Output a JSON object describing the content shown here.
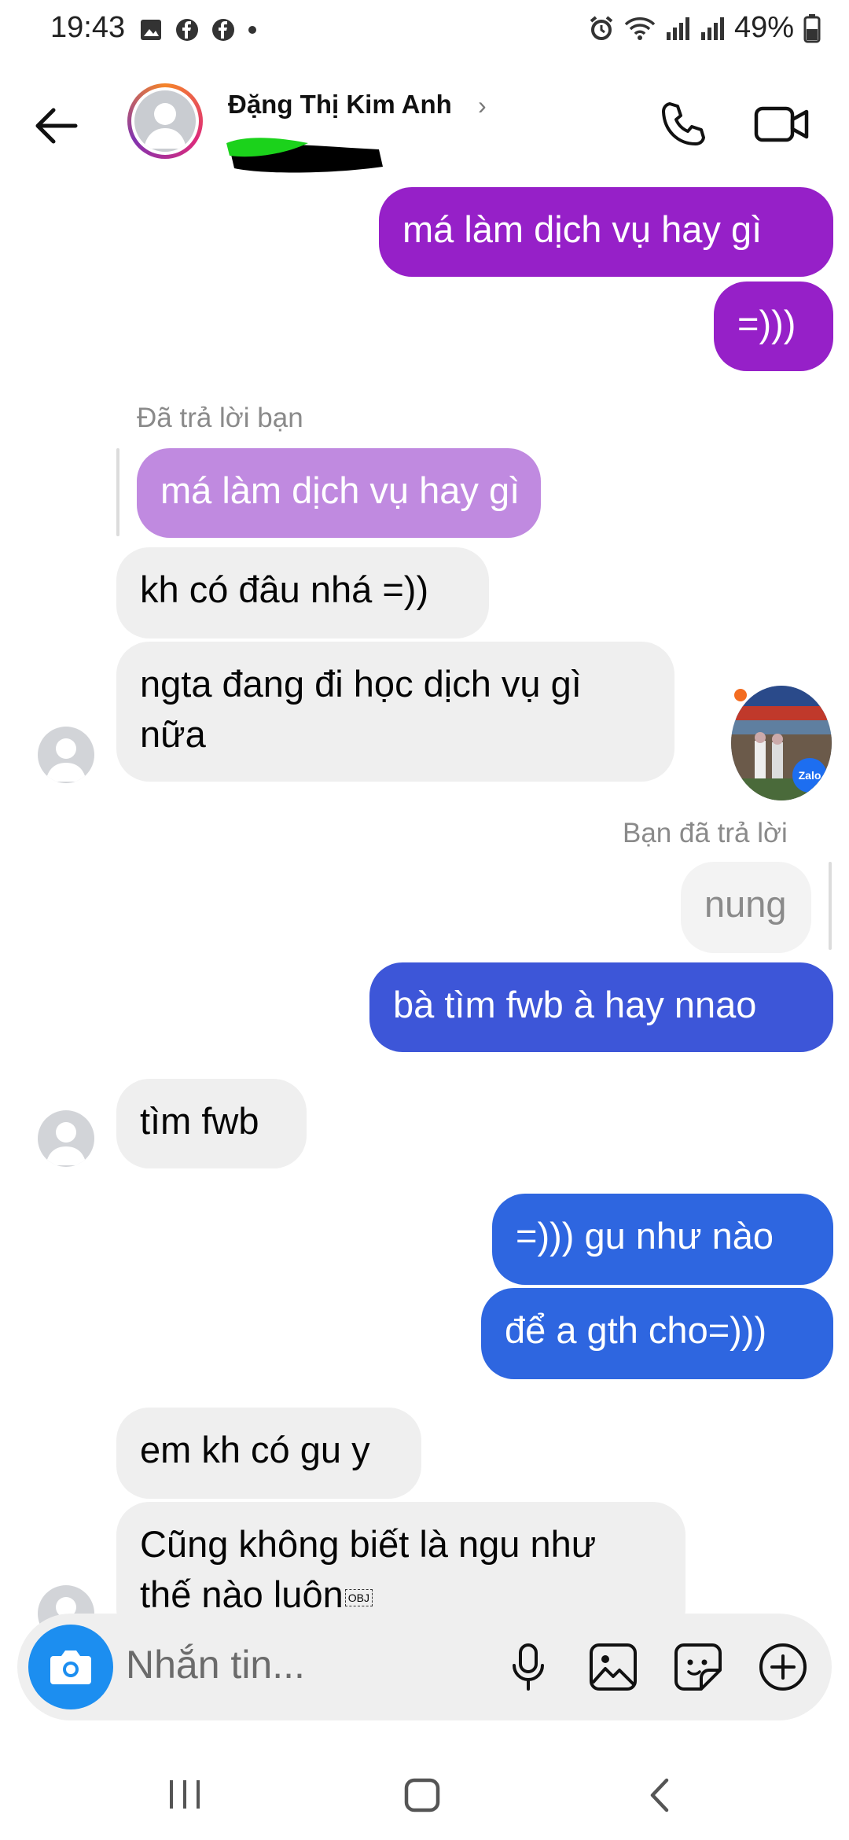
{
  "status_bar": {
    "time": "19:43",
    "battery": "49%"
  },
  "header": {
    "contact_name": "Đặng Thị Kim Anh",
    "chevron": "›"
  },
  "messages": [
    {
      "side": "out",
      "text": "má làm dịch vụ hay gì"
    },
    {
      "side": "out",
      "text": "=)))"
    },
    {
      "side": "in",
      "reply_label": "Đã trả lời bạn",
      "quoted": "má làm dịch vụ hay gì"
    },
    {
      "side": "in",
      "text": "kh có đâu nhá =))"
    },
    {
      "side": "in",
      "text_line1": "ngta đang đi học dịch vụ gì",
      "text_line2": "nữa"
    },
    {
      "side": "out",
      "reply_label": "Bạn đã trả lời",
      "quoted": "nung"
    },
    {
      "side": "out",
      "text": "bà tìm fwb à hay nnao"
    },
    {
      "side": "in",
      "text": "tìm fwb"
    },
    {
      "side": "out",
      "text": "=))) gu như nào"
    },
    {
      "side": "out",
      "text": "để a gth cho=)))"
    },
    {
      "side": "in",
      "text": "em kh có gu y"
    },
    {
      "side": "in",
      "text_line1": "Cũng không biết là ngu như",
      "text_line2": "thế nào luôn",
      "obj_glyph": "OBJ"
    }
  ],
  "seen_badge": "Zalo",
  "composer": {
    "placeholder": "Nhắn tin..."
  },
  "icons": [
    "back-arrow-icon",
    "phone-icon",
    "video-camera-icon",
    "camera-icon",
    "microphone-icon",
    "image-icon",
    "sticker-icon",
    "plus-circle-icon"
  ],
  "colors": {
    "purple": "#9620c8",
    "blue": "#3d56d8",
    "blue2": "#2e66e0",
    "light_purple": "#c08ae0",
    "incoming": "#efefef"
  }
}
